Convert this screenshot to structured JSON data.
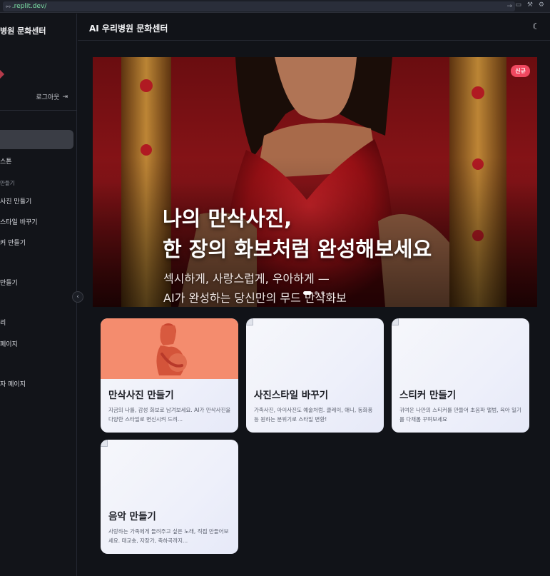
{
  "browser": {
    "url_host": ".replit.dev/"
  },
  "sidebar": {
    "title": "병원 문화센터",
    "logout_label": "로그아웃",
    "items": [
      {
        "label": "스톤",
        "style": "normal"
      },
      {
        "label": "만들기",
        "style": "small"
      },
      {
        "label": "사진 만들기",
        "style": "normal"
      },
      {
        "label": "스타일 바꾸기",
        "style": "normal"
      },
      {
        "label": "커 만들기",
        "style": "normal"
      },
      {
        "label": "만들기",
        "style": "normal"
      },
      {
        "label": "리",
        "style": "normal"
      },
      {
        "label": "페이지",
        "style": "normal"
      },
      {
        "label": "자 페이지",
        "style": "normal"
      }
    ]
  },
  "header": {
    "title": "AI 우리병원 문화센터"
  },
  "hero": {
    "badge": "신규",
    "headline_line1": "나의 만삭사진,",
    "headline_line2": "한 장의 화보처럼 완성해보세요",
    "sub_line1": "섹시하게, 사랑스럽게, 우아하게 —",
    "sub_line2": "AI가 완성하는 당신만의 무드 만삭화보",
    "slide_count": 3,
    "active_slide": 1
  },
  "cards": [
    {
      "title": "만삭사진 만들기",
      "desc": "지금의 나를, 감성 화보로 남겨보세요. AI가 만삭사진을 다양한 스타일로 변신시켜 드려..."
    },
    {
      "title": "사진스타일 바꾸기",
      "desc": "가족사진, 아이사진도 예술처럼. 클레이, 애니, 동화풍 등 원하는 분위기로 스타일 변환!"
    },
    {
      "title": "스티커 만들기",
      "desc": "귀여운 나만의 스티커를 만들어 초음파 앨범, 육아 일기를 다채롭 꾸며보세요"
    },
    {
      "title": "음악 만들기",
      "desc": "사랑하는 가족에게 들려주고 싶은 노래, 직접 만들어보세요. 태교송, 자장가, 축하곡까지..."
    }
  ],
  "colors": {
    "accent_badge": "#f0485f",
    "card_header": "#f48c6e",
    "bg": "#111318"
  }
}
